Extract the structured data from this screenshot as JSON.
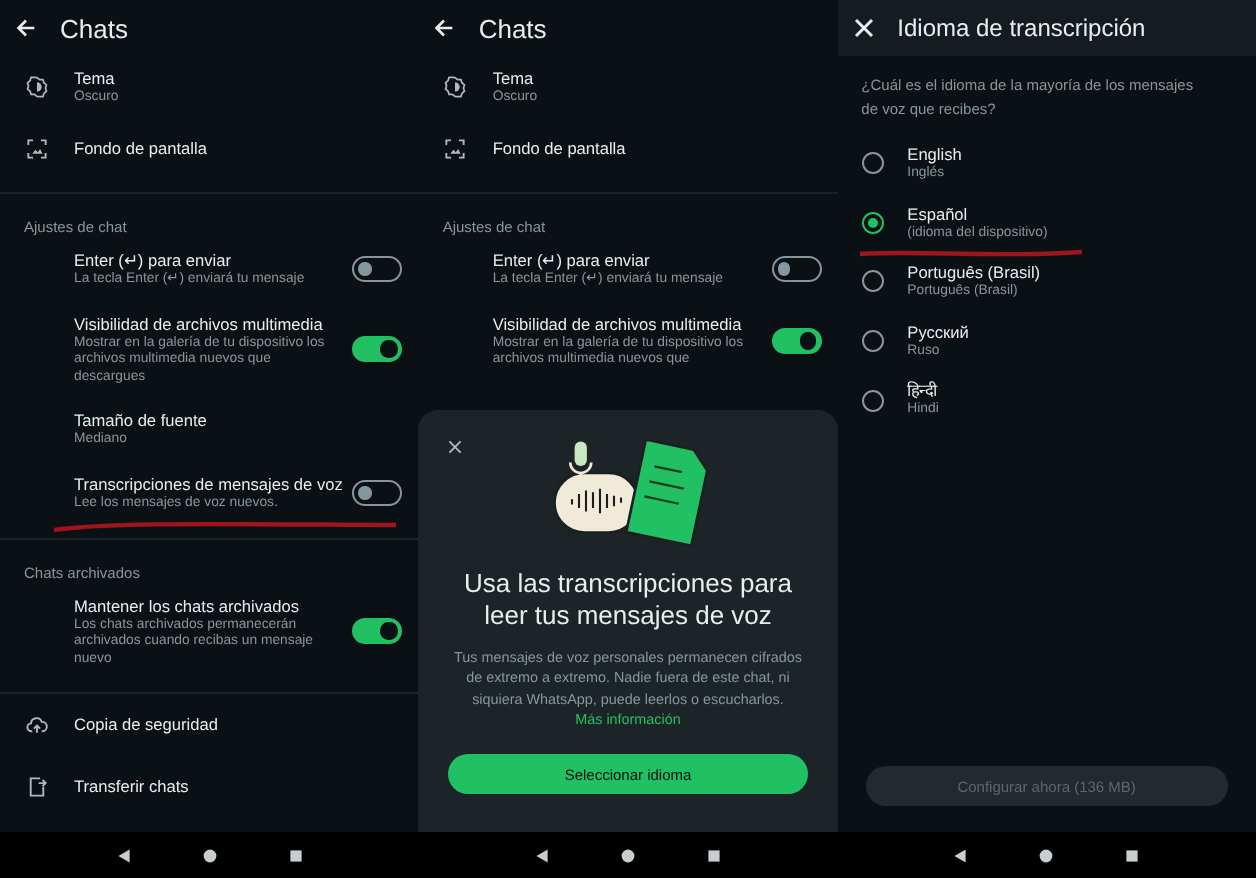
{
  "panels": [
    {
      "kind": "settings",
      "title": "Chats",
      "sections": [
        {
          "items": [
            {
              "kind": "icon",
              "title": "Tema",
              "subtitle": "Oscuro"
            },
            {
              "kind": "icon",
              "title": "Fondo de pantalla"
            }
          ]
        },
        {
          "header": "Ajustes de chat",
          "items": [
            {
              "kind": "toggle",
              "title": "Enter (↵) para enviar",
              "subtitle": "La tecla Enter (↵) enviará tu mensaje",
              "on": false
            },
            {
              "kind": "toggle",
              "title": "Visibilidad de archivos multimedia",
              "subtitle": "Mostrar en la galería de tu dispositivo los archivos multimedia nuevos que descargues",
              "on": true
            },
            {
              "kind": "plain",
              "title": "Tamaño de fuente",
              "subtitle": "Mediano"
            },
            {
              "kind": "toggle",
              "title": "Transcripciones de mensajes de voz",
              "subtitle": "Lee los mensajes de voz nuevos.",
              "on": false,
              "underlined": true
            }
          ]
        },
        {
          "header": "Chats archivados",
          "items": [
            {
              "kind": "toggle",
              "title": "Mantener los chats archivados",
              "subtitle": "Los chats archivados permanecerán archivados cuando recibas un mensaje nuevo",
              "on": true
            }
          ]
        },
        {
          "items": [
            {
              "kind": "icon",
              "title": "Copia de seguridad"
            },
            {
              "kind": "icon",
              "title": "Transferir chats"
            }
          ]
        }
      ]
    },
    {
      "kind": "settings",
      "title": "Chats",
      "sections": [
        {
          "items": [
            {
              "kind": "icon",
              "title": "Tema",
              "subtitle": "Oscuro"
            },
            {
              "kind": "icon",
              "title": "Fondo de pantalla"
            }
          ]
        },
        {
          "header": "Ajustes de chat",
          "items": [
            {
              "kind": "toggle",
              "title": "Enter (↵) para enviar",
              "subtitle": "La tecla Enter (↵) enviará tu mensaje",
              "on": false
            },
            {
              "kind": "toggle",
              "title": "Visibilidad de archivos multimedia",
              "subtitle": "Mostrar en la galería de tu dispositivo los archivos multimedia nuevos que",
              "on": true
            }
          ]
        }
      ],
      "sheet": {
        "title": "Usa las transcripciones para leer tus mensajes de voz",
        "body": "Tus mensajes de voz personales permanecen cifrados de extremo a extremo. Nadie fuera de este chat, ni siquiera WhatsApp, puede leerlos o escucharlos.",
        "link": "Más información",
        "button": "Seleccionar idioma"
      }
    },
    {
      "kind": "language",
      "title": "Idioma de transcripción",
      "question": "¿Cuál es el idioma de la mayoría de los mensajes de voz que recibes?",
      "options": [
        {
          "title": "English",
          "subtitle": "Inglés",
          "selected": false
        },
        {
          "title": "Español",
          "subtitle": "(idioma del dispositivo)",
          "selected": true,
          "underlined": true
        },
        {
          "title": "Português (Brasil)",
          "subtitle": "Português (Brasil)",
          "selected": false
        },
        {
          "title": "Русский",
          "subtitle": "Ruso",
          "selected": false
        },
        {
          "title": "हिन्दी",
          "subtitle": "Hindi",
          "selected": false
        }
      ],
      "button": {
        "label": "Configurar ahora (136 MB)",
        "disabled": true
      }
    }
  ]
}
